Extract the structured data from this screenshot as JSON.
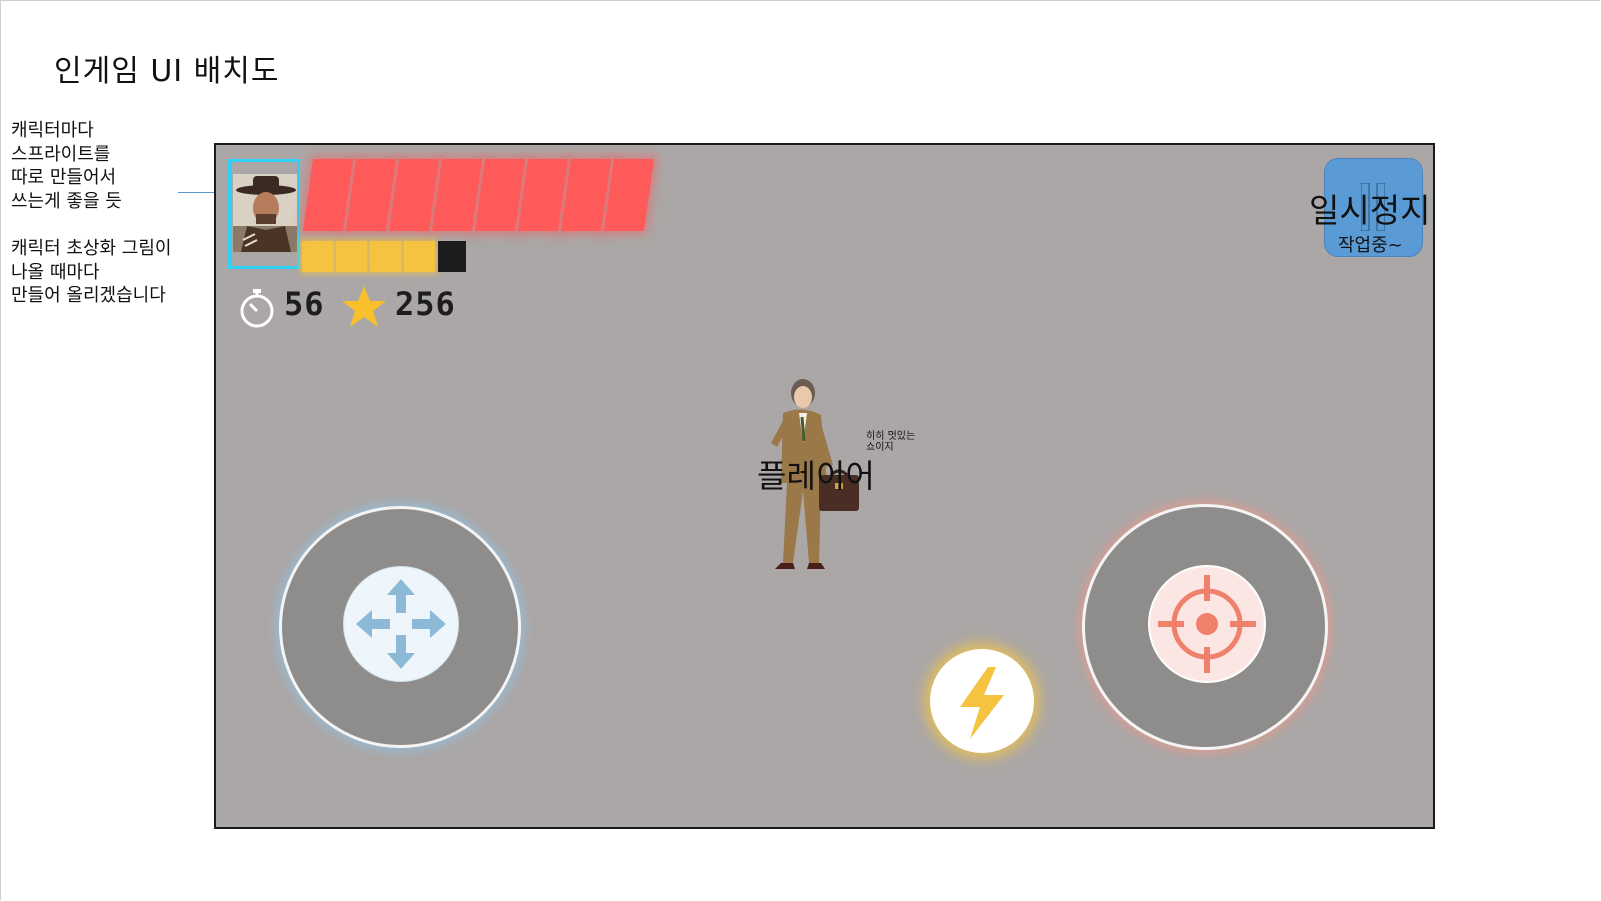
{
  "document": {
    "title": "인게임 UI 배치도",
    "note_sprite": "캐릭터마다\n스프라이트를\n따로 만들어서\n쓰는게 좋을 듯",
    "note_portrait": "캐릭터 초상화 그림이\n나올 때마다\n만들어 올리겠습니다"
  },
  "hud": {
    "hp_segments_filled": 8,
    "mp_segments_filled": 4,
    "mp_segments_total": 5,
    "timer_icon": "stopwatch-icon",
    "timer_value": "56",
    "score_icon": "star-icon",
    "score_value": "256",
    "pause_label": "일시정지",
    "pause_sub": "작업중~"
  },
  "player": {
    "label": "플레이어",
    "speech": "히히 멋있는\n쇼이지"
  },
  "controls": {
    "move_icon": "four-way-arrow-icon",
    "fire_icon": "crosshair-icon",
    "skill_icon": "lightning-bolt-icon"
  },
  "colors": {
    "game_bg": "#aba7a7",
    "hp": "#ff5a5a",
    "mp": "#f6c341",
    "portrait_frame": "#2fd2f4",
    "pause": "#5b9bd5"
  }
}
